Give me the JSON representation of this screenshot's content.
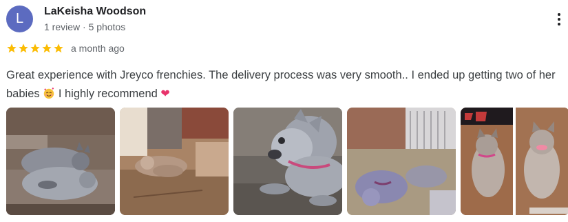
{
  "reviewer": {
    "initial": "L",
    "name": "LaKeisha Woodson",
    "meta": "1 review · 5 photos",
    "avatar_color": "#5c6bc0"
  },
  "more_menu": {
    "icon": "more-vert-icon"
  },
  "rating": {
    "stars": 5,
    "max_stars": 5,
    "star_color": "#fbbc04",
    "date": "a month ago"
  },
  "review": {
    "text_part1": "Great experience with Jreyco frenchies. The delivery process was very smooth.. I ended up getting two of her babies",
    "emoji1": "smiling-face-with-hearts-emoji",
    "text_part2": " I highly recommend",
    "emoji2": "heart-emoji"
  },
  "photos": [
    {
      "subject": "two merle french bulldogs lying on a couch"
    },
    {
      "subject": "french bulldog puppies playing on a wood floor"
    },
    {
      "subject": "merle french bulldog with pink collar lying on floor"
    },
    {
      "subject": "two french bulldogs sleeping near a pet crate"
    },
    {
      "subject": "collage of two merle french bulldogs sitting"
    }
  ]
}
